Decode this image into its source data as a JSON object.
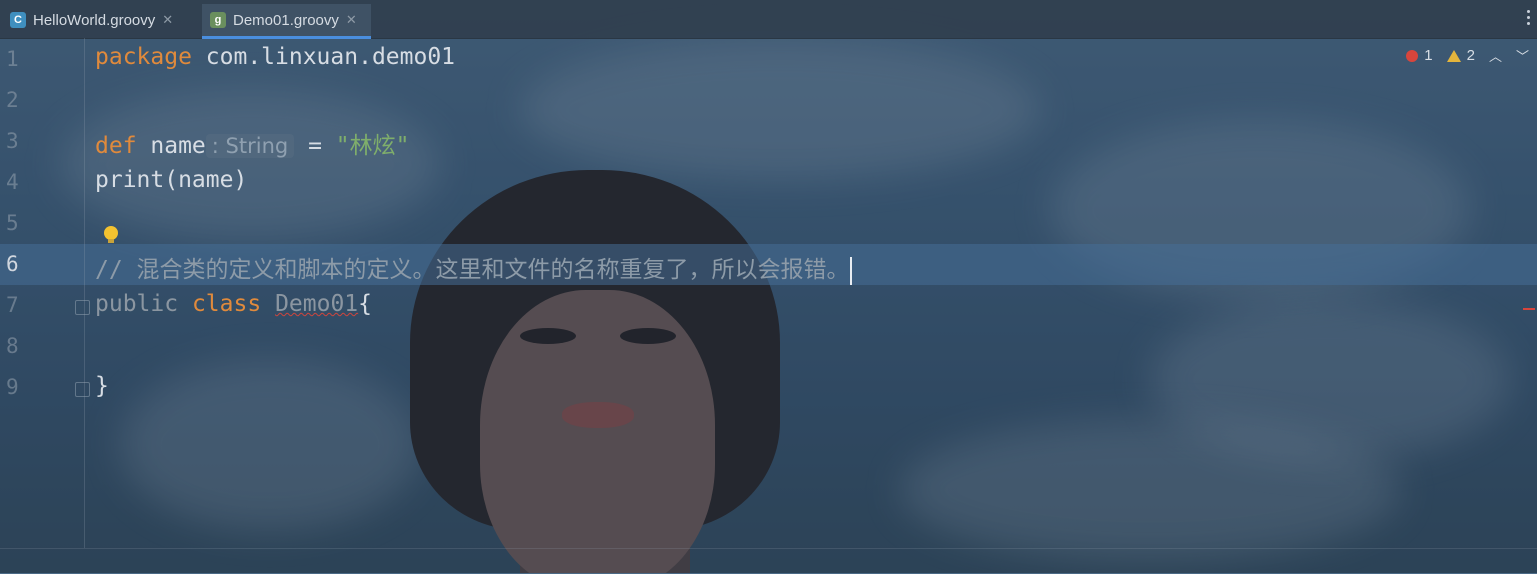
{
  "tabs": [
    {
      "label": "HelloWorld.groovy",
      "icon": "groovy-class-file-icon",
      "active": false
    },
    {
      "label": "Demo01.groovy",
      "icon": "groovy-script-file-icon",
      "active": true
    }
  ],
  "line_numbers": [
    "1",
    "2",
    "3",
    "4",
    "5",
    "6",
    "7",
    "8",
    "9"
  ],
  "current_line": "6",
  "code": {
    "line1": {
      "keyword": "package",
      "rest": " com.linxuan.demo01"
    },
    "line3": {
      "keyword": "def",
      "ident": " name",
      "type_hint": ": String",
      "op": " = ",
      "string": "\"林炫\""
    },
    "line4": {
      "text": "print(name)"
    },
    "line6": {
      "comment": "// 混合类的定义和脚本的定义。这里和文件的名称重复了，所以会报错。"
    },
    "line7": {
      "mod": "public",
      "keyword": "class",
      "name": "Demo01",
      "brace": "{"
    },
    "line9": {
      "brace": "}"
    }
  },
  "inspections": {
    "errors": "1",
    "warnings": "2"
  },
  "colors": {
    "keyword": "#e08a3c",
    "string": "#7fae6b",
    "error": "#d8453c",
    "warning": "#e4b53c",
    "active_tab_border": "#4a8ede"
  }
}
